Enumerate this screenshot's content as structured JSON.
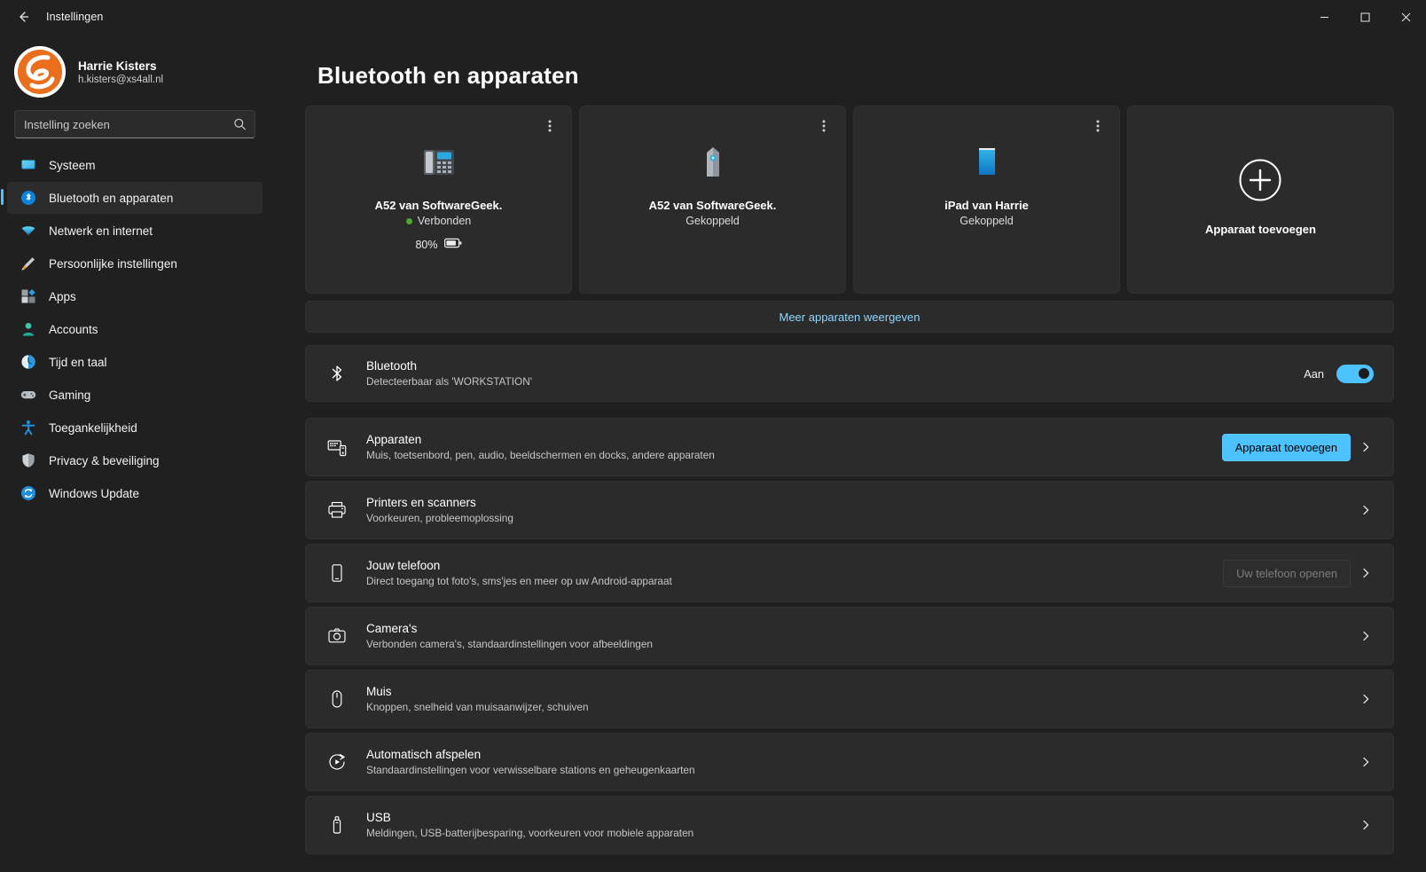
{
  "window": {
    "title": "Instellingen",
    "back_icon": "arrow-left-icon",
    "minimize_label": "—",
    "maximize_label": "□",
    "close_label": "✕"
  },
  "account": {
    "name": "Harrie Kisters",
    "email": "h.kisters@xs4all.nl",
    "avatar_icon": "user-avatar"
  },
  "search": {
    "placeholder": "Instelling zoeken",
    "value": "",
    "icon": "search-icon"
  },
  "sidebar": {
    "items": [
      {
        "label": "Systeem",
        "icon": "monitor-icon",
        "selected": false
      },
      {
        "label": "Bluetooth en apparaten",
        "icon": "bluetooth-icon",
        "selected": true
      },
      {
        "label": "Netwerk en internet",
        "icon": "wifi-icon",
        "selected": false
      },
      {
        "label": "Persoonlijke instellingen",
        "icon": "paintbrush-icon",
        "selected": false
      },
      {
        "label": "Apps",
        "icon": "apps-icon",
        "selected": false
      },
      {
        "label": "Accounts",
        "icon": "person-icon",
        "selected": false
      },
      {
        "label": "Tijd en taal",
        "icon": "clock-icon",
        "selected": false
      },
      {
        "label": "Gaming",
        "icon": "gamepad-icon",
        "selected": false
      },
      {
        "label": "Toegankelijkheid",
        "icon": "accessibility-icon",
        "selected": false
      },
      {
        "label": "Privacy & beveiliging",
        "icon": "shield-icon",
        "selected": false
      },
      {
        "label": "Windows Update",
        "icon": "update-icon",
        "selected": false
      }
    ]
  },
  "page": {
    "title": "Bluetooth en apparaten"
  },
  "devices": [
    {
      "name": "A52 van SoftwareGeek.",
      "status": "Verbonden",
      "connected": true,
      "battery": "80%",
      "icon": "desk-phone-icon",
      "menu_icon": "more-vertical-icon"
    },
    {
      "name": "A52 van SoftwareGeek.",
      "status": "Gekoppeld",
      "connected": false,
      "battery": "",
      "icon": "speaker-tower-icon",
      "menu_icon": "more-vertical-icon"
    },
    {
      "name": "iPad van Harrie",
      "status": "Gekoppeld",
      "connected": false,
      "battery": "",
      "icon": "tablet-icon",
      "menu_icon": "more-vertical-icon"
    }
  ],
  "add_device_card": {
    "label": "Apparaat toevoegen",
    "icon": "plus-circle-icon"
  },
  "more_devices": {
    "label": "Meer apparaten weergeven"
  },
  "bluetooth": {
    "title": "Bluetooth",
    "subtitle": "Detecteerbaar als 'WORKSTATION'",
    "toggle_label": "Aan",
    "toggle_on": true,
    "icon": "bluetooth-icon"
  },
  "settings_rows": [
    {
      "title": "Apparaten",
      "subtitle": "Muis, toetsenbord, pen, audio, beeldschermen en docks, andere apparaten",
      "icon": "devices-icon",
      "button": "Apparaat toevoegen",
      "button_state": "accent",
      "chevron": "chevron-right-icon"
    },
    {
      "title": "Printers en scanners",
      "subtitle": "Voorkeuren, probleemoplossing",
      "icon": "printer-icon",
      "button": "",
      "button_state": "none",
      "chevron": "chevron-right-icon"
    },
    {
      "title": "Jouw telefoon",
      "subtitle": "Direct toegang tot foto's, sms'jes en meer op uw Android-apparaat",
      "icon": "phone-icon",
      "button": "Uw telefoon openen",
      "button_state": "disabled",
      "chevron": "chevron-right-icon"
    },
    {
      "title": "Camera's",
      "subtitle": "Verbonden camera's, standaardinstellingen voor afbeeldingen",
      "icon": "camera-icon",
      "button": "",
      "button_state": "none",
      "chevron": "chevron-right-icon"
    },
    {
      "title": "Muis",
      "subtitle": "Knoppen, snelheid van muisaanwijzer, schuiven",
      "icon": "mouse-icon",
      "button": "",
      "button_state": "none",
      "chevron": "chevron-right-icon"
    },
    {
      "title": "Automatisch afspelen",
      "subtitle": "Standaardinstellingen voor verwisselbare stations en geheugenkaarten",
      "icon": "autoplay-icon",
      "button": "",
      "button_state": "none",
      "chevron": "chevron-right-icon"
    },
    {
      "title": "USB",
      "subtitle": "Meldingen, USB-batterijbesparing, voorkeuren voor mobiele apparaten",
      "icon": "usb-icon",
      "button": "",
      "button_state": "none",
      "chevron": "chevron-right-icon"
    }
  ],
  "colors": {
    "accent": "#4cc2ff",
    "link": "#8fd6ff",
    "online": "#4ea72e",
    "window_bg": "#202020",
    "card_bg": "#2b2b2b"
  }
}
